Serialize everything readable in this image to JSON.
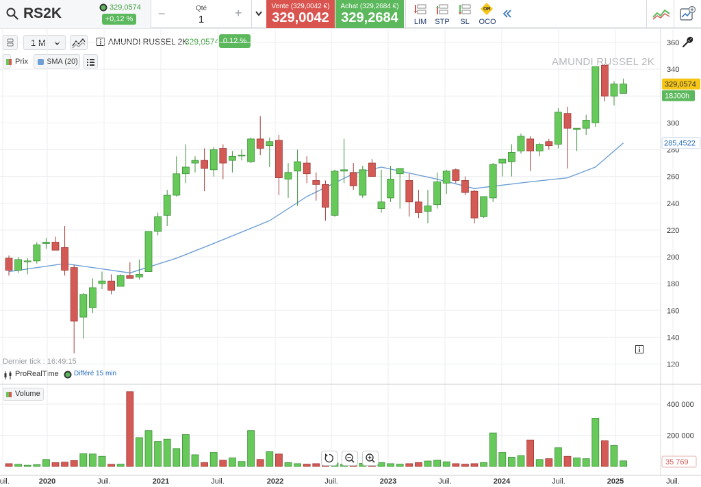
{
  "toolbar": {
    "symbol": "RS2K",
    "last_price": "329,0574",
    "change": "+0,12 %",
    "qty_label": "Qté",
    "qty_value": "1",
    "qty_minus": "−",
    "qty_plus": "+",
    "sell_label": "Vente (329,0042 €)",
    "sell_price": "329,0042",
    "buy_label": "Achat (329,2684 €)",
    "buy_price": "329,2684",
    "order_types": [
      "LIM",
      "STP",
      "SL",
      "OCO"
    ],
    "oco_badge": "OR"
  },
  "chart_toolbar": {
    "period": "1 M",
    "instrument": "AMUNDI RUSSEL 2K",
    "price": "329,0574",
    "change": "0.12 %",
    "legend_price": "Prix",
    "legend_sma": "SMA (20)",
    "watermark": "AMUNDI RUSSEL 2K",
    "last_tick": "Dernier tick : 16:49:15",
    "provider": "ProRealTime",
    "delay": "Différé 15 min",
    "volume_label": "Volume"
  },
  "colors": {
    "up": "#66c95a",
    "down": "#d35a55",
    "sma": "#6d9fd6",
    "accent_green": "#5cb85c",
    "accent_red": "#d9534f"
  },
  "chart_data": {
    "type": "candlestick",
    "interval": "monthly",
    "y_ticks": [
      "360",
      "340",
      "320",
      "300",
      "280",
      "260",
      "240",
      "220",
      "200",
      "180",
      "160",
      "140",
      "120"
    ],
    "ylim": [
      110,
      364
    ],
    "x_labels": [
      "Juil.",
      "2020",
      "Juil.",
      "2021",
      "Juil.",
      "2022",
      "Juil.",
      "2023",
      "Juil.",
      "2024",
      "Juil.",
      "2025",
      "Juil."
    ],
    "price_tag": "329,0574",
    "time_tag": "18J00h",
    "sma_tag": "285,4522",
    "volume_ticks": [
      "400 000",
      "200 000"
    ],
    "volume_tag": "35 769",
    "volume_ylim": [
      0,
      480000
    ],
    "candles": [
      {
        "o": 199,
        "h": 201,
        "l": 186,
        "c": 190
      },
      {
        "o": 190,
        "h": 200,
        "l": 188,
        "c": 198
      },
      {
        "o": 197,
        "h": 199,
        "l": 187,
        "c": 197
      },
      {
        "o": 197,
        "h": 211,
        "l": 195,
        "c": 209
      },
      {
        "o": 210,
        "h": 214,
        "l": 206,
        "c": 211
      },
      {
        "o": 211,
        "h": 215,
        "l": 205,
        "c": 205
      },
      {
        "o": 207,
        "h": 223,
        "l": 186,
        "c": 190
      },
      {
        "o": 192,
        "h": 194,
        "l": 128,
        "c": 152
      },
      {
        "o": 155,
        "h": 173,
        "l": 139,
        "c": 172
      },
      {
        "o": 162,
        "h": 184,
        "l": 158,
        "c": 177
      },
      {
        "o": 180,
        "h": 189,
        "l": 176,
        "c": 182
      },
      {
        "o": 182,
        "h": 187,
        "l": 172,
        "c": 175
      },
      {
        "o": 178,
        "h": 187,
        "l": 178,
        "c": 186
      },
      {
        "o": 186,
        "h": 196,
        "l": 184,
        "c": 184
      },
      {
        "o": 185,
        "h": 198,
        "l": 183,
        "c": 187
      },
      {
        "o": 189,
        "h": 219,
        "l": 189,
        "c": 219
      },
      {
        "o": 219,
        "h": 233,
        "l": 216,
        "c": 230
      },
      {
        "o": 231,
        "h": 250,
        "l": 223,
        "c": 246
      },
      {
        "o": 246,
        "h": 275,
        "l": 245,
        "c": 262
      },
      {
        "o": 262,
        "h": 284,
        "l": 255,
        "c": 267
      },
      {
        "o": 270,
        "h": 275,
        "l": 263,
        "c": 272
      },
      {
        "o": 272,
        "h": 281,
        "l": 249,
        "c": 266
      },
      {
        "o": 265,
        "h": 282,
        "l": 260,
        "c": 280
      },
      {
        "o": 281,
        "h": 284,
        "l": 258,
        "c": 270
      },
      {
        "o": 272,
        "h": 279,
        "l": 263,
        "c": 275
      },
      {
        "o": 276,
        "h": 280,
        "l": 272,
        "c": 276
      },
      {
        "o": 271,
        "h": 289,
        "l": 270,
        "c": 288
      },
      {
        "o": 288,
        "h": 305,
        "l": 276,
        "c": 281
      },
      {
        "o": 283,
        "h": 289,
        "l": 267,
        "c": 286
      },
      {
        "o": 287,
        "h": 291,
        "l": 246,
        "c": 259
      },
      {
        "o": 258,
        "h": 270,
        "l": 244,
        "c": 263
      },
      {
        "o": 264,
        "h": 280,
        "l": 238,
        "c": 271
      },
      {
        "o": 270,
        "h": 275,
        "l": 255,
        "c": 262
      },
      {
        "o": 257,
        "h": 263,
        "l": 242,
        "c": 254
      },
      {
        "o": 254,
        "h": 257,
        "l": 227,
        "c": 237
      },
      {
        "o": 231,
        "h": 265,
        "l": 230,
        "c": 264
      },
      {
        "o": 264,
        "h": 288,
        "l": 255,
        "c": 265
      },
      {
        "o": 263,
        "h": 270,
        "l": 250,
        "c": 253
      },
      {
        "o": 246,
        "h": 268,
        "l": 244,
        "c": 265
      },
      {
        "o": 270,
        "h": 273,
        "l": 264,
        "c": 260
      },
      {
        "o": 236,
        "h": 265,
        "l": 233,
        "c": 241
      },
      {
        "o": 244,
        "h": 268,
        "l": 241,
        "c": 258
      },
      {
        "o": 262,
        "h": 264,
        "l": 236,
        "c": 266
      },
      {
        "o": 257,
        "h": 262,
        "l": 230,
        "c": 241
      },
      {
        "o": 241,
        "h": 250,
        "l": 229,
        "c": 233
      },
      {
        "o": 234,
        "h": 250,
        "l": 225,
        "c": 238
      },
      {
        "o": 239,
        "h": 263,
        "l": 236,
        "c": 256
      },
      {
        "o": 255,
        "h": 265,
        "l": 247,
        "c": 264
      },
      {
        "o": 265,
        "h": 266,
        "l": 255,
        "c": 257
      },
      {
        "o": 257,
        "h": 260,
        "l": 246,
        "c": 248
      },
      {
        "o": 249,
        "h": 250,
        "l": 225,
        "c": 229
      },
      {
        "o": 230,
        "h": 245,
        "l": 229,
        "c": 245
      },
      {
        "o": 244,
        "h": 270,
        "l": 241,
        "c": 269
      },
      {
        "o": 270,
        "h": 273,
        "l": 260,
        "c": 273
      },
      {
        "o": 271,
        "h": 284,
        "l": 260,
        "c": 278
      },
      {
        "o": 279,
        "h": 292,
        "l": 277,
        "c": 290
      },
      {
        "o": 288,
        "h": 290,
        "l": 264,
        "c": 279
      },
      {
        "o": 279,
        "h": 285,
        "l": 275,
        "c": 284
      },
      {
        "o": 286,
        "h": 288,
        "l": 280,
        "c": 283
      },
      {
        "o": 284,
        "h": 311,
        "l": 281,
        "c": 308
      },
      {
        "o": 307,
        "h": 312,
        "l": 266,
        "c": 296
      },
      {
        "o": 295,
        "h": 296,
        "l": 279,
        "c": 296
      },
      {
        "o": 296,
        "h": 306,
        "l": 291,
        "c": 302
      },
      {
        "o": 300,
        "h": 342,
        "l": 297,
        "c": 342
      },
      {
        "o": 343,
        "h": 344,
        "l": 316,
        "c": 320
      },
      {
        "o": 320,
        "h": 331,
        "l": 313,
        "c": 329
      },
      {
        "o": 322,
        "h": 333,
        "l": 322,
        "c": 329
      }
    ],
    "volumes": [
      18000,
      14000,
      8000,
      12000,
      45000,
      25000,
      28000,
      38000,
      82000,
      80000,
      65000,
      14000,
      15000,
      480000,
      185000,
      230000,
      160000,
      175000,
      115000,
      205000,
      75000,
      25000,
      90000,
      40000,
      55000,
      32000,
      230000,
      45000,
      95000,
      80000,
      25000,
      18000,
      15000,
      18000,
      28000,
      22000,
      15000,
      14000,
      20000,
      28000,
      25000,
      18000,
      15000,
      18000,
      25000,
      35000,
      40000,
      30000,
      18000,
      15000,
      18000,
      25000,
      215000,
      90000,
      60000,
      70000,
      170000,
      45000,
      50000,
      120000,
      65000,
      55000,
      50000,
      310000,
      165000,
      135000,
      36000
    ],
    "sma": [
      [
        0,
        189
      ],
      [
        6,
        195
      ],
      [
        10,
        191
      ],
      [
        13,
        188
      ],
      [
        18,
        199
      ],
      [
        22,
        210
      ],
      [
        28,
        227
      ],
      [
        32,
        245
      ],
      [
        37,
        262
      ],
      [
        40,
        267
      ],
      [
        46,
        258
      ],
      [
        50,
        251
      ],
      [
        56,
        256
      ],
      [
        60,
        259
      ],
      [
        63,
        267
      ],
      [
        66,
        285
      ]
    ]
  }
}
